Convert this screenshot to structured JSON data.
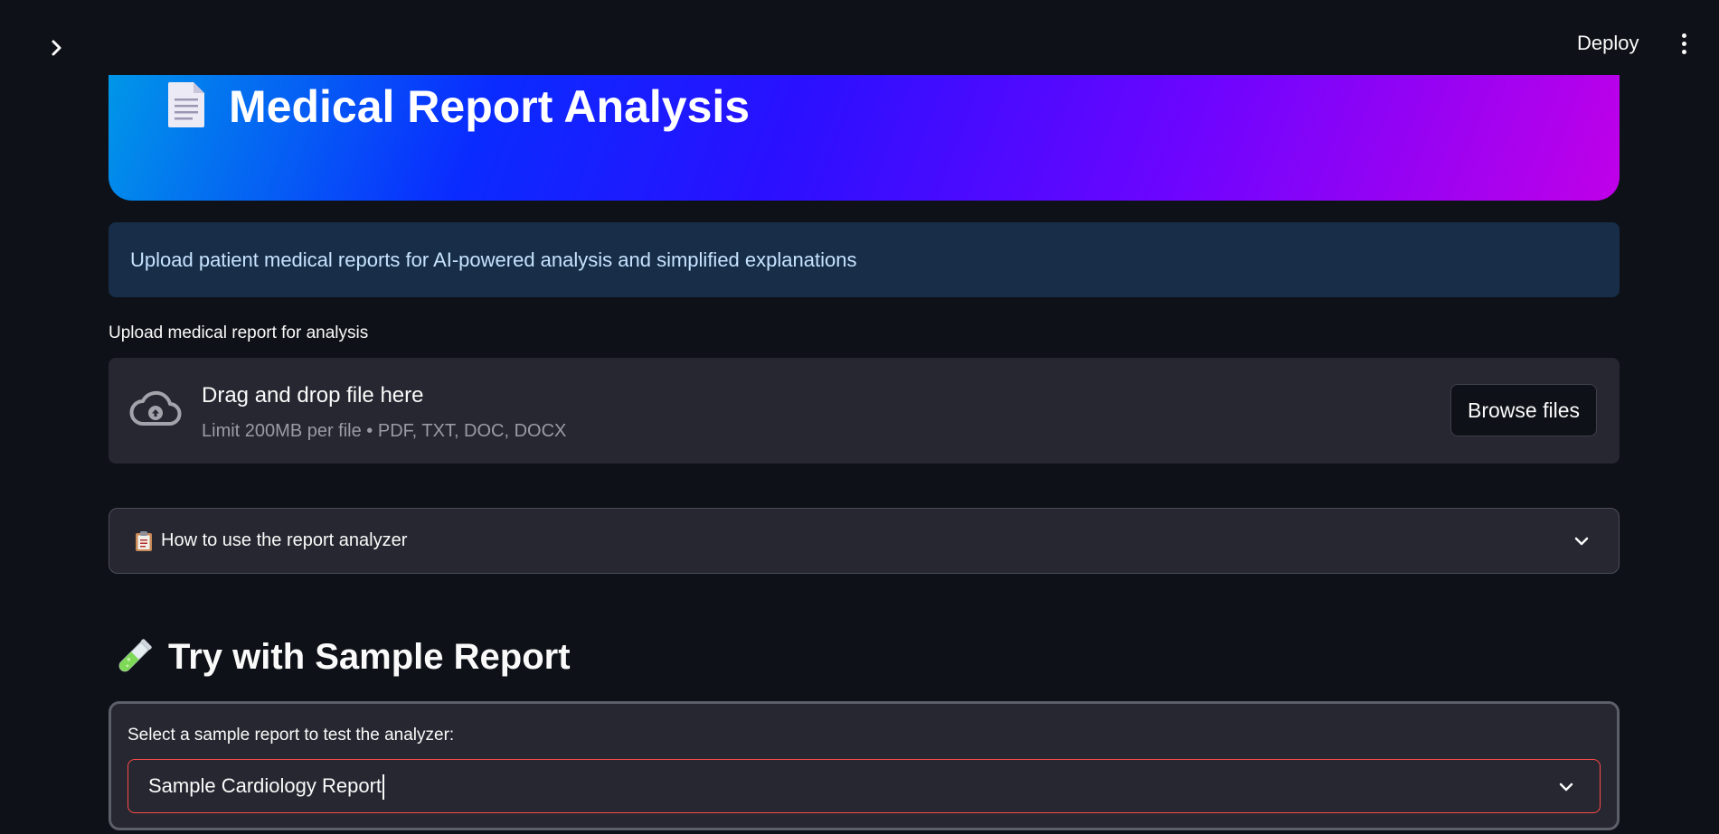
{
  "topbar": {
    "toggle_icon": "chevron-right-icon",
    "deploy_label": "Deploy",
    "menu_icon": "kebab-menu-icon"
  },
  "hero": {
    "icon": "document-icon",
    "title": "Medical Report Analysis",
    "gradient_colors": [
      "#0096e8",
      "#0a2bff",
      "#6a05ff",
      "#c000e8"
    ]
  },
  "info": {
    "text": "Upload patient medical reports for AI-powered analysis and simplified explanations"
  },
  "uploader": {
    "label": "Upload medical report for analysis",
    "icon": "cloud-upload-icon",
    "drop_title": "Drag and drop file here",
    "drop_sub": "Limit 200MB per file • PDF, TXT, DOC, DOCX",
    "browse_label": "Browse files"
  },
  "expander": {
    "icon": "clipboard-icon",
    "label": "How to use the report analyzer",
    "expanded": false
  },
  "sample": {
    "icon": "test-tube-icon",
    "title": "Try with Sample Report",
    "select_label": "Select a sample report to test the analyzer:",
    "selected_value": "Sample Cardiology Report",
    "accent_color": "#ff4b4b"
  }
}
